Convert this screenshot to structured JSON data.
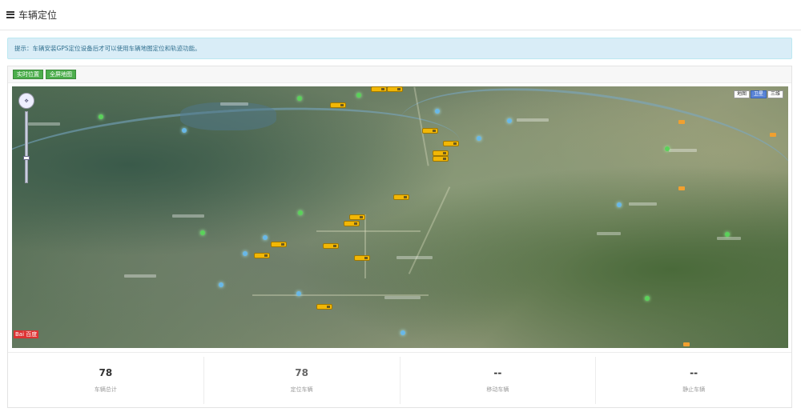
{
  "header": {
    "title": "车辆定位",
    "menu_icon": "menu-icon"
  },
  "tip": {
    "text": "提示：车辆安装GPS定位设备后才可以使用车辆地图定位和轨迹功能。"
  },
  "toolbar": {
    "realtime_label": "实时位置",
    "fullscreen_label": "全屏地图"
  },
  "map": {
    "type_options": [
      "地图",
      "卫星",
      "三维"
    ],
    "selected_type": "卫星",
    "logo": "Bai 百度"
  },
  "stats": [
    {
      "value": "78",
      "label": "车辆总计"
    },
    {
      "value": "78",
      "label": "定位车辆"
    },
    {
      "value": "--",
      "label": "移动车辆"
    },
    {
      "value": "--",
      "label": "静止车辆"
    }
  ],
  "colors": {
    "tip_bg": "#d9edf7",
    "tip_text": "#31708f",
    "button_green": "#4cae4c",
    "vehicle_yellow": "#f2b705"
  }
}
